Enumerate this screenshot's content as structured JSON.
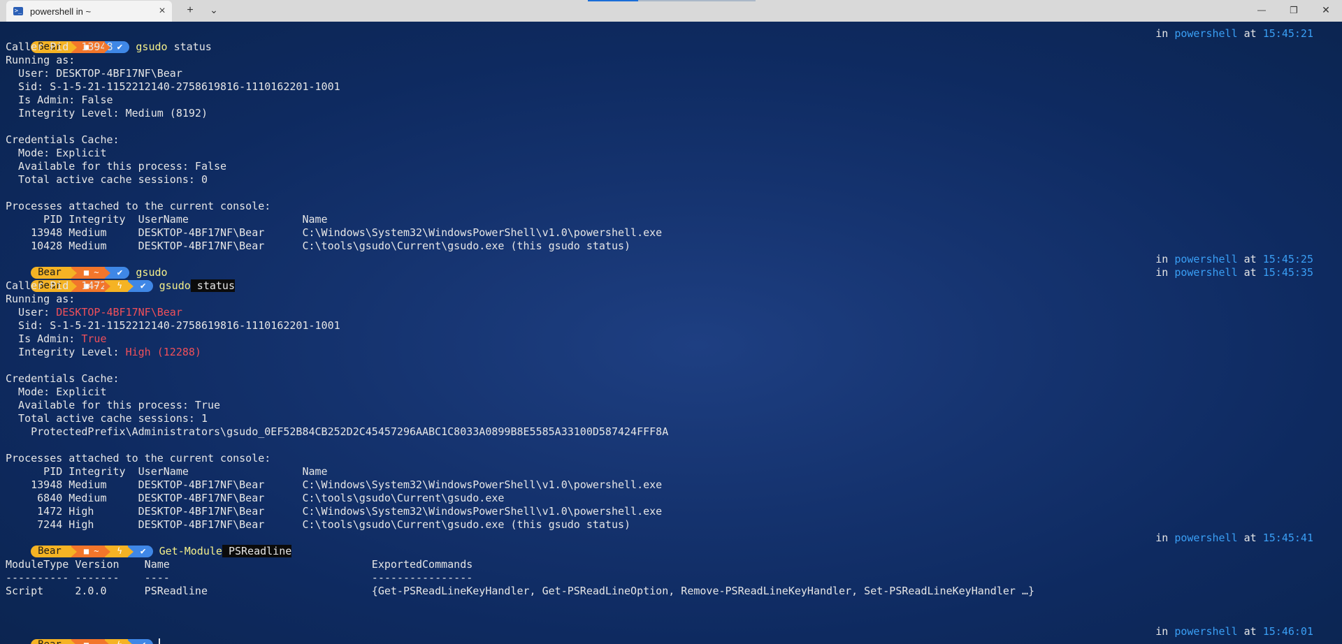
{
  "window": {
    "tab_title": "powershell in ~",
    "tab_icon": "powershell-icon",
    "new_tab": "+",
    "dropdown": "⌄",
    "minimize": "—",
    "maximize": "❐",
    "close": "✕",
    "tab_close": "×",
    "progress": 0.3
  },
  "prompt": {
    "user": "Bear",
    "dir": "■ ~",
    "elevated": "ϟ",
    "ok": "✔",
    "in_label": "in ",
    "shell": "powershell",
    "at_label": " at "
  },
  "times": [
    "15:45:21",
    "15:45:25",
    "15:45:35",
    "15:45:41",
    "15:46:01"
  ],
  "commands": {
    "c1_cmd": "gsudo",
    "c1_args": " status",
    "c2_cmd": "gsudo",
    "c3_cmd": "gsudo",
    "c3_args": " status",
    "c4_cmd": "Get-Module",
    "c4_args": " PSReadline"
  },
  "block1": {
    "l1": "Caller Pid: 13948",
    "l2": "Running as:",
    "l3": "  User: DESKTOP-4BF17NF\\Bear",
    "l4": "  Sid: S-1-5-21-1152212140-2758619816-1110162201-1001",
    "l5": "  Is Admin: False",
    "l6": "  Integrity Level: Medium (8192)",
    "l8": "Credentials Cache:",
    "l9": "  Mode: Explicit",
    "l10": "  Available for this process: False",
    "l11": "  Total active cache sessions: 0",
    "l13": "Processes attached to the current console:",
    "l14": "      PID Integrity  UserName                  Name",
    "l15": "    13948 Medium     DESKTOP-4BF17NF\\Bear      C:\\Windows\\System32\\WindowsPowerShell\\v1.0\\powershell.exe",
    "l16": "    10428 Medium     DESKTOP-4BF17NF\\Bear      C:\\tools\\gsudo\\Current\\gsudo.exe (this gsudo status)"
  },
  "block2": {
    "l1": "Caller Pid: 1472",
    "l2": "Running as:",
    "user_label": "  User: ",
    "user_value": "DESKTOP-4BF17NF\\Bear",
    "l4": "  Sid: S-1-5-21-1152212140-2758619816-1110162201-1001",
    "admin_label": "  Is Admin: ",
    "admin_value": "True",
    "integrity_label": "  Integrity Level: ",
    "integrity_value": "High (12288)",
    "l8": "Credentials Cache:",
    "l9": "  Mode: Explicit",
    "l10": "  Available for this process: True",
    "l11": "  Total active cache sessions: 1",
    "l12": "    ProtectedPrefix\\Administrators\\gsudo_0EF52B84CB252D2C45457296AABC1C8033A0899B8E5585A33100D587424FFF8A",
    "l14": "Processes attached to the current console:",
    "l15": "      PID Integrity  UserName                  Name",
    "l16": "    13948 Medium     DESKTOP-4BF17NF\\Bear      C:\\Windows\\System32\\WindowsPowerShell\\v1.0\\powershell.exe",
    "l17": "     6840 Medium     DESKTOP-4BF17NF\\Bear      C:\\tools\\gsudo\\Current\\gsudo.exe",
    "l18": "     1472 High       DESKTOP-4BF17NF\\Bear      C:\\Windows\\System32\\WindowsPowerShell\\v1.0\\powershell.exe",
    "l19": "     7244 High       DESKTOP-4BF17NF\\Bear      C:\\tools\\gsudo\\Current\\gsudo.exe (this gsudo status)"
  },
  "block3": {
    "h": "ModuleType Version    Name                                ExportedCommands",
    "d": "---------- -------    ----                                ----------------",
    "r": "Script     2.0.0      PSReadline                          {Get-PSReadLineKeyHandler, Get-PSReadLineOption, Remove-PSReadLineKeyHandler, Set-PSReadLineKeyHandler …}"
  }
}
